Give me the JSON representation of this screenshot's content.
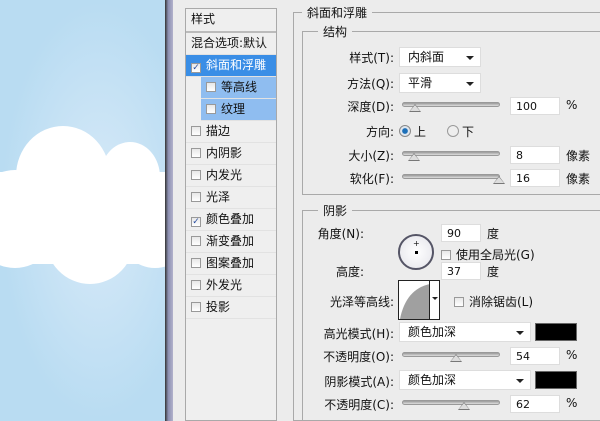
{
  "styles_panel": {
    "header": "样式",
    "blend": "混合选项:默认",
    "items": [
      {
        "label": "斜面和浮雕",
        "checked": true
      },
      {
        "label": "等高线",
        "checked": false
      },
      {
        "label": "纹理",
        "checked": false
      },
      {
        "label": "描边",
        "checked": false
      },
      {
        "label": "内阴影",
        "checked": false
      },
      {
        "label": "内发光",
        "checked": false
      },
      {
        "label": "光泽",
        "checked": false
      },
      {
        "label": "颜色叠加",
        "checked": true
      },
      {
        "label": "渐变叠加",
        "checked": false
      },
      {
        "label": "图案叠加",
        "checked": false
      },
      {
        "label": "外发光",
        "checked": false
      },
      {
        "label": "投影",
        "checked": false
      }
    ]
  },
  "bevel": {
    "title": "斜面和浮雕",
    "structure": {
      "title": "结构",
      "style_label": "样式(T):",
      "style_value": "内斜面",
      "method_label": "方法(Q):",
      "method_value": "平滑",
      "depth_label": "深度(D):",
      "depth_value": "100",
      "depth_unit": "%",
      "direction_label": "方向:",
      "dir_up": "上",
      "dir_down": "下",
      "direction_selected": "上",
      "size_label": "大小(Z):",
      "size_value": "8",
      "size_unit": "像素",
      "soften_label": "软化(F):",
      "soften_value": "16",
      "soften_unit": "像素"
    },
    "shading": {
      "title": "阴影",
      "angle_label": "角度(N):",
      "angle_value": "90",
      "angle_unit": "度",
      "global_light": "使用全局光(G)",
      "altitude_label": "高度:",
      "altitude_value": "37",
      "altitude_unit": "度",
      "gloss_label": "光泽等高线:",
      "antialias": "消除锯齿(L)",
      "highlight_label": "高光模式(H):",
      "highlight_mode": "颜色加深",
      "highlight_color": "#000000",
      "opacity1_label": "不透明度(O):",
      "opacity1_value": "54",
      "opacity1_unit": "%",
      "shadow_label": "阴影模式(A):",
      "shadow_mode": "颜色加深",
      "shadow_color": "#000000",
      "opacity2_label": "不透明度(C):",
      "opacity2_value": "62",
      "opacity2_unit": "%"
    }
  },
  "colors": {
    "selected": "#3a8ee6",
    "sub": "#8fbdf0"
  }
}
